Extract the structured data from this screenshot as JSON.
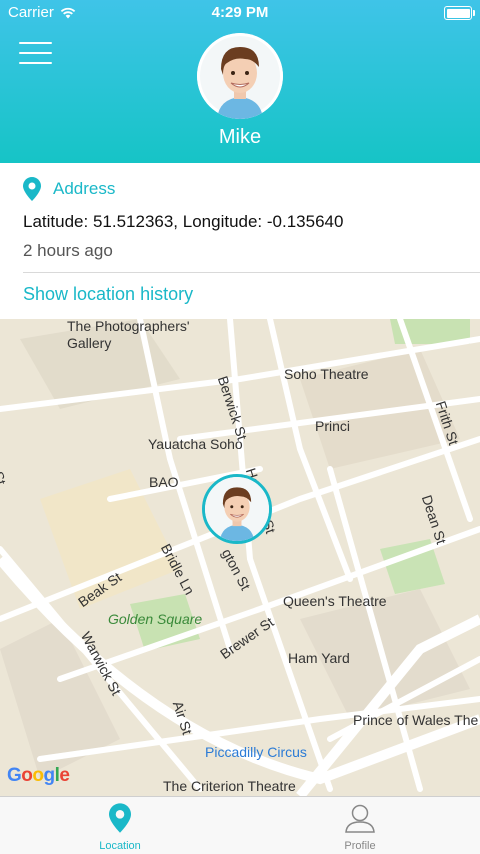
{
  "status_bar": {
    "carrier": "Carrier",
    "time": "4:29 PM"
  },
  "header": {
    "user_name": "Mike",
    "menu_icon": "hamburger-menu-icon"
  },
  "location": {
    "address_label": "Address",
    "coordinates": "Latitude: 51.512363, Longitude: -0.135640",
    "time_ago": "2 hours ago",
    "history_link": "Show location history"
  },
  "map": {
    "labels": {
      "photographers_gallery_1": "The Photographers'",
      "photographers_gallery_2": "Gallery",
      "berwick_st": "Berwick St",
      "soho_theatre": "Soho Theatre",
      "frith_st": "Frith St",
      "princi": "Princi",
      "yauatcha": "Yauatcha Soho",
      "bao": "BAO",
      "hopkins_st": "Hopkins St",
      "dean_st": "Dean St",
      "st_left": "y St",
      "beak_st": "Beak St",
      "bridle_ln": "Bridle Ln",
      "upton_st": "gton St",
      "queens_theatre": "Queen's Theatre",
      "golden_square": "Golden Square",
      "brewer_st": "Brewer St",
      "ham_yard": "Ham Yard",
      "warwick_st": "Warwick St",
      "air_st": "Air St",
      "prince_of_wales": "Prince of Wales The",
      "piccadilly_circus": "Piccadilly Circus",
      "criterion": "The Criterion Theatre"
    },
    "attribution": "Google"
  },
  "tabs": [
    {
      "label": "Location",
      "icon": "location-pin-icon",
      "active": true
    },
    {
      "label": "Profile",
      "icon": "profile-icon",
      "active": false
    }
  ],
  "colors": {
    "accent": "#1ab8c8",
    "header_top": "#3fc4e8",
    "header_bottom": "#16c4c6"
  }
}
